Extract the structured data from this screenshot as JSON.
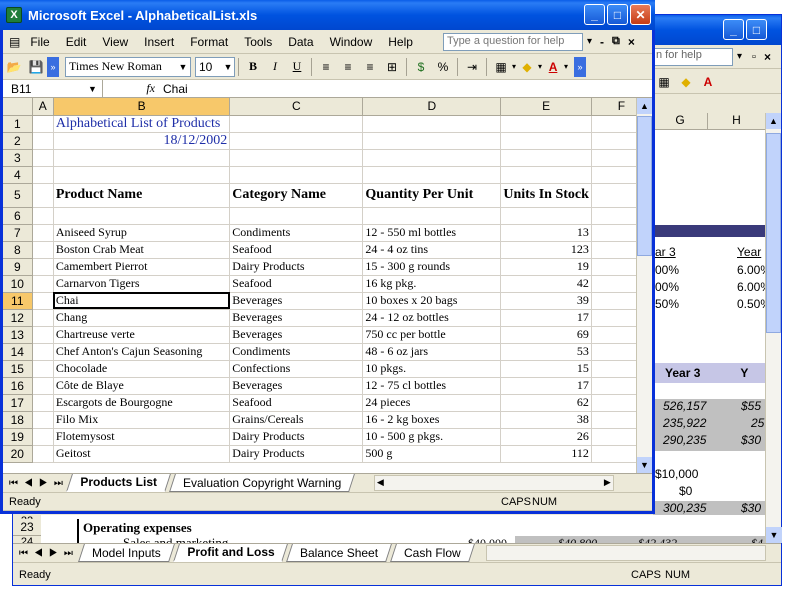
{
  "front": {
    "title": "Microsoft Excel - AlphabeticalList.xls",
    "menu": [
      "File",
      "Edit",
      "View",
      "Insert",
      "Format",
      "Tools",
      "Data",
      "Window",
      "Help"
    ],
    "help_placeholder": "Type a question for help",
    "font_name": "Times New Roman",
    "font_size": "10",
    "name_box": "B11",
    "formula_value": "Chai",
    "columns": [
      "A",
      "B",
      "C",
      "D",
      "E",
      "F"
    ],
    "rows": [
      {
        "n": "1",
        "b": "Alphabetical List of Products",
        "c": "",
        "d": "",
        "e": ""
      },
      {
        "n": "2",
        "b": "18/12/2002",
        "c": "",
        "d": "",
        "e": ""
      },
      {
        "n": "3",
        "b": "",
        "c": "",
        "d": "",
        "e": ""
      },
      {
        "n": "4",
        "b": "",
        "c": "",
        "d": "",
        "e": ""
      },
      {
        "n": "5",
        "b": "Product Name",
        "c": "Category Name",
        "d": "Quantity Per Unit",
        "e": "Units In Stock"
      },
      {
        "n": "6",
        "b": "",
        "c": "",
        "d": "",
        "e": ""
      },
      {
        "n": "7",
        "b": "Aniseed Syrup",
        "c": "Condiments",
        "d": "12 - 550 ml bottles",
        "e": "13"
      },
      {
        "n": "8",
        "b": "Boston Crab Meat",
        "c": "Seafood",
        "d": "24 - 4 oz tins",
        "e": "123"
      },
      {
        "n": "9",
        "b": "Camembert Pierrot",
        "c": "Dairy Products",
        "d": "15 - 300 g rounds",
        "e": "19"
      },
      {
        "n": "10",
        "b": "Carnarvon Tigers",
        "c": "Seafood",
        "d": "16 kg pkg.",
        "e": "42"
      },
      {
        "n": "11",
        "b": "Chai",
        "c": "Beverages",
        "d": "10 boxes x 20 bags",
        "e": "39"
      },
      {
        "n": "12",
        "b": "Chang",
        "c": "Beverages",
        "d": "24 - 12 oz bottles",
        "e": "17"
      },
      {
        "n": "13",
        "b": "Chartreuse verte",
        "c": "Beverages",
        "d": "750 cc per bottle",
        "e": "69"
      },
      {
        "n": "14",
        "b": "Chef Anton's Cajun Seasoning",
        "c": "Condiments",
        "d": "48 - 6 oz jars",
        "e": "53"
      },
      {
        "n": "15",
        "b": "Chocolade",
        "c": "Confections",
        "d": "10 pkgs.",
        "e": "15"
      },
      {
        "n": "16",
        "b": "Côte de Blaye",
        "c": "Beverages",
        "d": "12 - 75 cl bottles",
        "e": "17"
      },
      {
        "n": "17",
        "b": "Escargots de Bourgogne",
        "c": "Seafood",
        "d": "24 pieces",
        "e": "62"
      },
      {
        "n": "18",
        "b": "Filo Mix",
        "c": "Grains/Cereals",
        "d": "16 - 2 kg boxes",
        "e": "38"
      },
      {
        "n": "19",
        "b": "Flotemysost",
        "c": "Dairy Products",
        "d": "10 - 500 g pkgs.",
        "e": "26"
      },
      {
        "n": "20",
        "b": "Geitost",
        "c": "Dairy Products",
        "d": "500 g",
        "e": "112"
      }
    ],
    "tabs": [
      "Products List",
      "Evaluation Copyright Warning"
    ],
    "status": "Ready",
    "caps": "CAPS",
    "num": "NUM"
  },
  "back": {
    "help_partial": "n for help",
    "columns": [
      "G",
      "H"
    ],
    "year3": "ar 3",
    "year_h": "Year",
    "pct_g": [
      "00%",
      "00%",
      "50%"
    ],
    "pct_h": [
      "6.00%",
      "6.00%",
      "0.50%"
    ],
    "year3_bold": "Year 3",
    "y_trunc": "Y",
    "vals_g": [
      "526,157",
      "235,922",
      "290,235"
    ],
    "vals_h": [
      "$55",
      "25",
      "$30"
    ],
    "vals_g2": [
      "$10,000",
      "$0",
      "300,235"
    ],
    "vals_h2": [
      "$30"
    ],
    "row22": "22",
    "row23": "23",
    "row23_label": "Operating expenses",
    "row24": "24",
    "row24_label": "Sales and marketing",
    "row24_vals": [
      "$40,000",
      "$40,800",
      "$42,432",
      "$4"
    ],
    "tabs": [
      "Model Inputs",
      "Profit and Loss",
      "Balance Sheet",
      "Cash Flow"
    ],
    "status": "Ready",
    "caps": "CAPS",
    "num": "NUM"
  }
}
